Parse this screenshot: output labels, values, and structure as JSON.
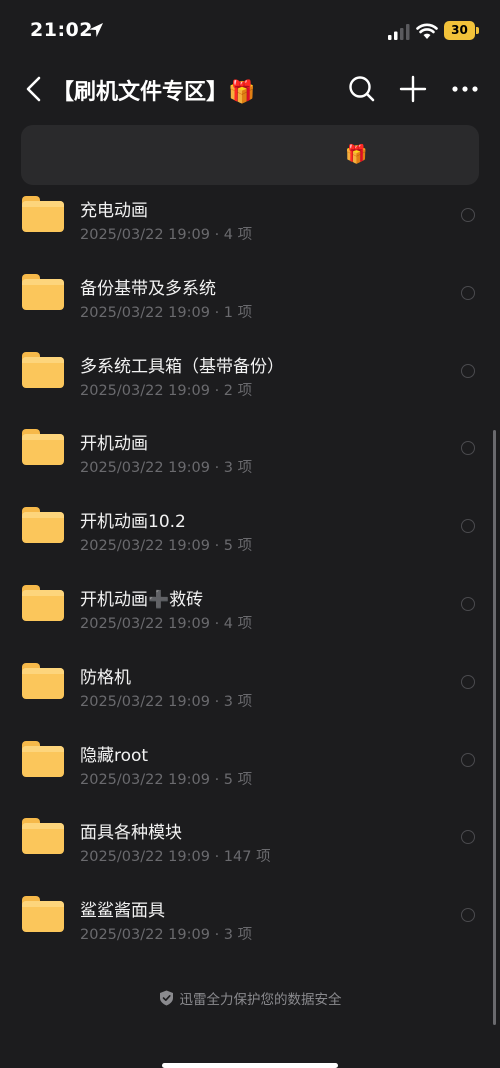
{
  "status_bar": {
    "time": "21:02",
    "battery": "30"
  },
  "nav": {
    "title": "【刷机文件专区】🎁"
  },
  "banner": {
    "gift": "🎁"
  },
  "files": [
    {
      "name": "充电动画",
      "meta": "2025/03/22 19:09 · 4 项"
    },
    {
      "name": "备份基带及多系统",
      "meta": "2025/03/22 19:09 · 1 项"
    },
    {
      "name": "多系统工具箱（基带备份）",
      "meta": "2025/03/22 19:09 · 2 项"
    },
    {
      "name": "开机动画",
      "meta": "2025/03/22 19:09 · 3 项"
    },
    {
      "name": "开机动画10.2",
      "meta": "2025/03/22 19:09 · 5 项"
    },
    {
      "name": "开机动画➕救砖",
      "meta": "2025/03/22 19:09 · 4 项"
    },
    {
      "name": "防格机",
      "meta": "2025/03/22 19:09 · 3 项"
    },
    {
      "name": "隐藏root",
      "meta": "2025/03/22 19:09 · 5 项"
    },
    {
      "name": "面具各种模块",
      "meta": "2025/03/22 19:09 · 147 项"
    },
    {
      "name": "鲨鲨酱面具",
      "meta": "2025/03/22 19:09 · 3 项"
    }
  ],
  "footer": {
    "text": "迅雷全力保护您的数据安全"
  },
  "colors": {
    "background": "#1c1c1e",
    "folder": "#fbc65b",
    "battery": "#f2c23a"
  }
}
